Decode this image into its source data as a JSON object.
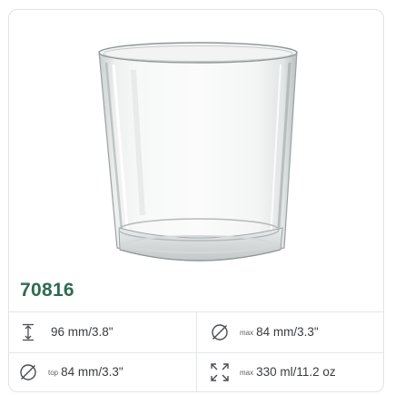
{
  "product": {
    "code": "70816",
    "image": {
      "subject": "glass-tumbler"
    }
  },
  "specs": [
    {
      "icon": "height-icon",
      "qualifier": "",
      "value": "96 mm/3.8\""
    },
    {
      "icon": "diameter-icon",
      "qualifier": "max",
      "value": "84 mm/3.3\""
    },
    {
      "icon": "diameter-icon",
      "qualifier": "top",
      "value": "84 mm/3.3\""
    },
    {
      "icon": "capacity-icon",
      "qualifier": "max",
      "value": "330 ml/11.2 oz"
    }
  ],
  "colors": {
    "accent": "#2f6b4f",
    "border": "#e3e6e8",
    "text": "#3a3d40"
  }
}
